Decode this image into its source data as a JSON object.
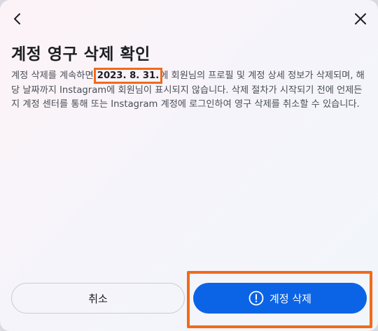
{
  "dialog": {
    "title": "계정 영구 삭제 확인",
    "body_before_date": "계정 삭제를 계속하면 ",
    "date": "2023. 8. 31.",
    "body_after_date": "에 회원님의 프로필 및 계정 상세 정보가 삭제되며, 해당 날짜까지 Instagram에 회원님이 표시되지 않습니다. 삭제 절차가 시작되기 전에 언제든지 계정 센터를 통해 또는 Instagram 계정에 로그인하여 영구 삭제를 취소할 수 있습니다."
  },
  "buttons": {
    "cancel_label": "취소",
    "delete_label": "계정 삭제"
  },
  "icons": {
    "back": "chevron-left-icon",
    "close": "close-icon",
    "delete": "alert-circle-icon"
  },
  "colors": {
    "primary": "#0b64e6",
    "highlight": "#f06a1b"
  }
}
